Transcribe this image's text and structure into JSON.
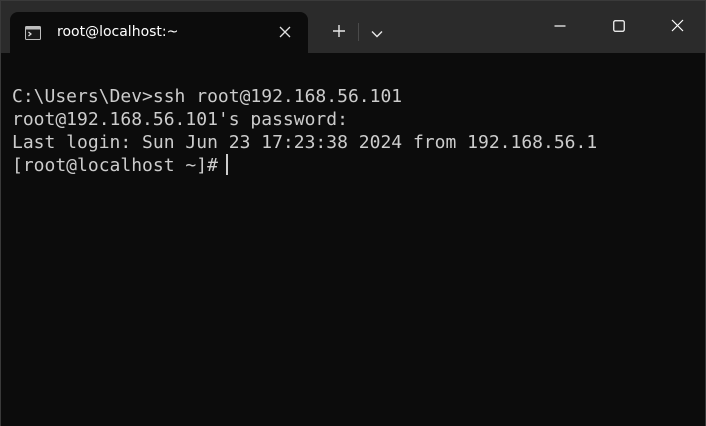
{
  "window": {
    "tab_title": "root@localhost:~"
  },
  "icons": {
    "tab": "terminal-icon",
    "tab_close": "close-icon",
    "new_tab": "plus-icon",
    "dropdown": "chevron-down-icon",
    "minimize": "minimize-icon",
    "maximize": "maximize-icon",
    "close": "close-icon"
  },
  "colors": {
    "background": "#0c0c0c",
    "titlebar": "#2b2b2b",
    "text": "#cccccc"
  },
  "terminal": {
    "lines": [
      "C:\\Users\\Dev>ssh root@192.168.56.101",
      "root@192.168.56.101's password:",
      "Last login: Sun Jun 23 17:23:38 2024 from 192.168.56.1",
      "[root@localhost ~]#"
    ]
  }
}
